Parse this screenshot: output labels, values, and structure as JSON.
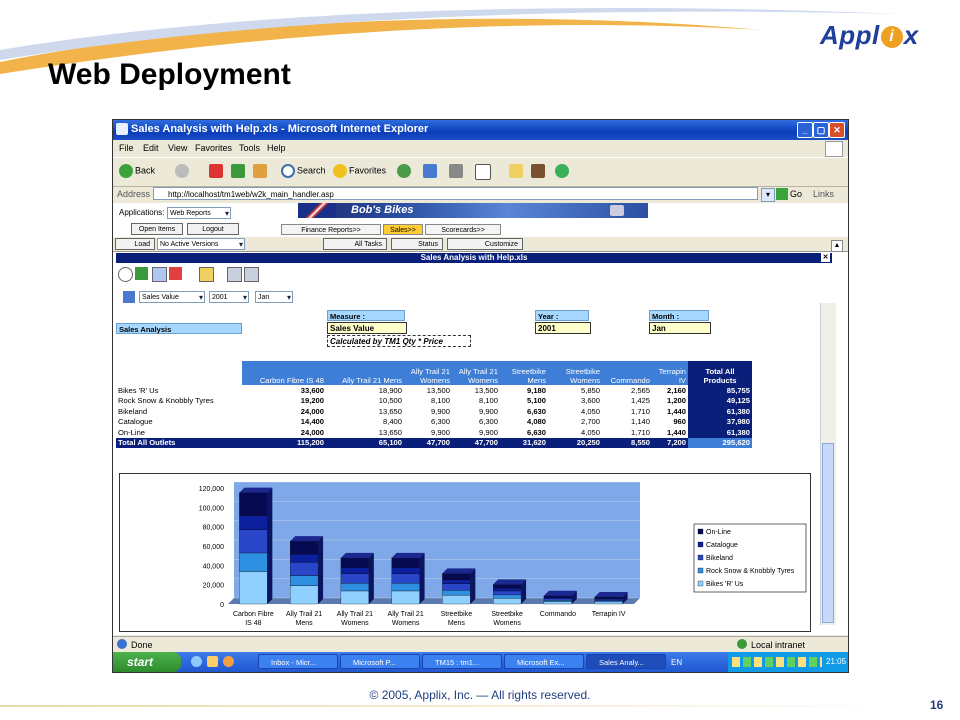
{
  "slide": {
    "title": "Web Deployment",
    "logo_prefix": "Appl",
    "logo_mark": "i",
    "logo_suffix": "x",
    "footer": "© 2005,  Applix, Inc. — All rights reserved.",
    "page_number": "16"
  },
  "window": {
    "title": "Sales Analysis with Help.xls - Microsoft Internet Explorer",
    "menu": [
      "File",
      "Edit",
      "View",
      "Favorites",
      "Tools",
      "Help"
    ],
    "toolbar": {
      "back": "Back",
      "search": "Search",
      "favorites": "Favorites"
    },
    "address_label": "Address",
    "address_url": "http://localhost/tm1web/w2k_main_handler.asp",
    "go": "Go",
    "links": "Links"
  },
  "app": {
    "applications_label": "Applications:",
    "applications_value": "Web Reports",
    "open_items": "Open Items",
    "logout": "Logout",
    "banner_title": "Bob's Bikes",
    "tabs": [
      "Finance Reports>>",
      "Sales>>",
      "Scorecards>>"
    ],
    "load": "Load",
    "versions": "No Active Versions",
    "all_tasks": "All Tasks",
    "status_btn": "Status",
    "customize": "Customize",
    "sheet_title": "Sales Analysis with Help.xls",
    "filters": {
      "measure_sel": "Sales Value",
      "year_sel": "2001",
      "month_sel": "Jan"
    },
    "sales_analysis": "Sales Analysis",
    "measure_label": "Measure :",
    "measure_value": "Sales Value",
    "calc_note": "Calculated by TM1 Qty * Price",
    "year_label": "Year :",
    "year_value": "2001",
    "month_label": "Month :",
    "month_value": "Jan"
  },
  "table": {
    "columns": [
      [
        "",
        "Carbon Fibre IS 48"
      ],
      [
        "",
        "Ally Trail 21 Mens"
      ],
      [
        "Ally Trail 21",
        "Womens"
      ],
      [
        "Ally Trail 21",
        "Womens"
      ],
      [
        "Streetbike",
        "Mens"
      ],
      [
        "Streetbike",
        "Womens"
      ],
      [
        "",
        "Commando"
      ],
      [
        "Terrapin",
        "IV"
      ]
    ],
    "total_col": [
      "Total All",
      "Products"
    ],
    "rows": [
      {
        "label": "Bikes 'R' Us",
        "values": [
          "33,600",
          "18,900",
          "13,500",
          "13,500",
          "9,180",
          "5,850",
          "2,565",
          "2,160"
        ],
        "total": "85,755"
      },
      {
        "label": "Rock Snow & Knobbly Tyres",
        "values": [
          "19,200",
          "10,500",
          "8,100",
          "8,100",
          "5,100",
          "3,600",
          "1,425",
          "1,200"
        ],
        "total": "49,125"
      },
      {
        "label": "Bikeland",
        "values": [
          "24,000",
          "13,650",
          "9,900",
          "9,900",
          "6,630",
          "4,050",
          "1,710",
          "1,440"
        ],
        "total": "61,380"
      },
      {
        "label": "Catalogue",
        "values": [
          "14,400",
          "8,400",
          "6,300",
          "6,300",
          "4,080",
          "2,700",
          "1,140",
          "960"
        ],
        "total": "37,980"
      },
      {
        "label": "On-Line",
        "values": [
          "24,000",
          "13,650",
          "9,900",
          "9,900",
          "6,630",
          "4,050",
          "1,710",
          "1,440"
        ],
        "total": "61,380"
      }
    ],
    "total_row": {
      "label": "Total All Outlets",
      "values": [
        "115,200",
        "65,100",
        "47,700",
        "47,700",
        "31,620",
        "20,250",
        "8,550",
        "7,200"
      ],
      "total": "295,620"
    }
  },
  "chart_data": {
    "type": "bar",
    "stacked": true,
    "categories": [
      "Carbon Fibre IS 48",
      "Ally Trail 21 Mens",
      "Ally Trail 21 Womens",
      "Ally Trail 21 Womens",
      "Streetbike Mens",
      "Streetbike Womens",
      "Commando",
      "Terrapin IV"
    ],
    "category_lines": [
      [
        "Carbon Fibre",
        "IS 48"
      ],
      [
        "Ally Trail 21",
        "Mens"
      ],
      [
        "Ally Trail 21",
        "Womens"
      ],
      [
        "Ally Trail 21",
        "Womens"
      ],
      [
        "Streetbike",
        "Mens"
      ],
      [
        "Streetbike",
        "Womens"
      ],
      [
        "Commando"
      ],
      [
        "Terrapin IV"
      ]
    ],
    "series": [
      {
        "name": "Bikes 'R' Us",
        "values": [
          33600,
          18900,
          13500,
          13500,
          9180,
          5850,
          2565,
          2160
        ],
        "color": "#8fd0ff"
      },
      {
        "name": "Rock Snow & Knobbly Tyres",
        "values": [
          19200,
          10500,
          8100,
          8100,
          5100,
          3600,
          1425,
          1200
        ],
        "color": "#2f8fe0"
      },
      {
        "name": "Bikeland",
        "values": [
          24000,
          13650,
          9900,
          9900,
          6630,
          4050,
          1710,
          1440
        ],
        "color": "#2a46c8"
      },
      {
        "name": "Catalogue",
        "values": [
          14400,
          8400,
          6300,
          6300,
          4080,
          2700,
          1140,
          960
        ],
        "color": "#0c1f9c"
      },
      {
        "name": "On-Line",
        "values": [
          24000,
          13650,
          9900,
          9900,
          6630,
          4050,
          1710,
          1440
        ],
        "color": "#060a50"
      }
    ],
    "yticks": [
      "0",
      "20,000",
      "40,000",
      "60,000",
      "80,000",
      "100,000",
      "120,000"
    ],
    "ylim": [
      0,
      120000
    ],
    "legend": "right"
  },
  "status": {
    "done": "Done",
    "zone": "Local intranet"
  },
  "taskbar": {
    "start": "start",
    "tasks": [
      "Inbox - Micr...",
      "Microsoft P...",
      "TM15 : tm1...",
      "Microsoft Ex...",
      "Sales Analy..."
    ],
    "lang": "EN",
    "clock": "21:05"
  },
  "colors": {
    "accent": "#0a1f7a",
    "header_blue": "#3f7ed6",
    "label_blue": "#a6d8ff"
  }
}
